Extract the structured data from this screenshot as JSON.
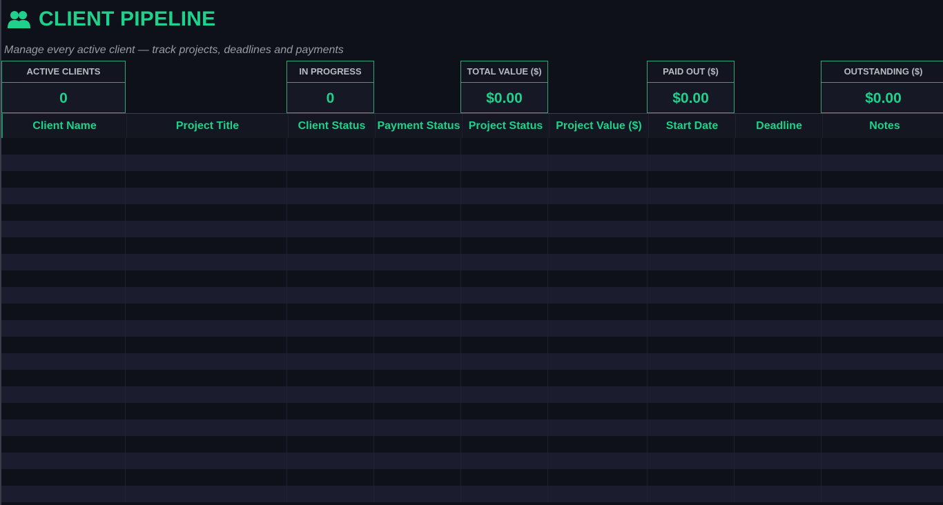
{
  "header": {
    "title": "CLIENT PIPELINE",
    "icon": "users-icon",
    "subtitle": "Manage every active client — track projects, deadlines and payments"
  },
  "kpis": [
    {
      "label": "ACTIVE CLIENTS",
      "value": "0"
    },
    {
      "label": "IN PROGRESS",
      "value": "0"
    },
    {
      "label": "TOTAL VALUE ($)",
      "value": "$0.00"
    },
    {
      "label": "PAID OUT ($)",
      "value": "$0.00"
    },
    {
      "label": "OUTSTANDING ($)",
      "value": "$0.00"
    }
  ],
  "table": {
    "columns": [
      "Client Name",
      "Project Title",
      "Client Status",
      "Payment Status",
      "Project Status",
      "Project Value ($)",
      "Start Date",
      "Deadline",
      "Notes"
    ]
  },
  "colors": {
    "accent": "#1fd18b",
    "background": "#0e101a",
    "row_alt": "#1b1d2e"
  }
}
